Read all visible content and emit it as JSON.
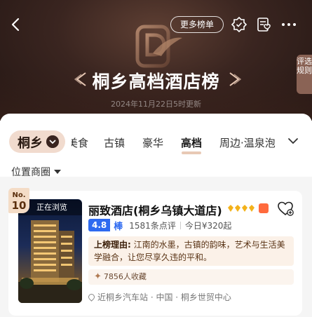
{
  "header": {
    "title": "桐乡高档酒店榜",
    "updated": "2024年11月22日5时更新",
    "more_lists_label": "更多榜单",
    "rules_label": "评选规则",
    "icons": [
      "back-arrow-icon",
      "badge-icon",
      "favorite-list-icon",
      "more-dots-icon"
    ],
    "colors": {
      "header_bg": "#3a2520",
      "accent_gold": "#e8c9b5"
    }
  },
  "tabs": {
    "city": "桐乡",
    "items": [
      "美食",
      "古镇",
      "豪华",
      "高档",
      "周边·温泉泡"
    ],
    "active": "高档"
  },
  "filter": {
    "label": "位置商圈"
  },
  "hotels": [
    {
      "rank_prefix": "No.",
      "rank": "10",
      "viewing_badge": "正在浏览",
      "name": "丽致酒店(桐乡乌镇大道店)",
      "diamonds": 4,
      "score": "4.8",
      "score_word": "棒",
      "reviews": "1581条点评",
      "price": "今日¥320起",
      "reason_label": "上榜理由:",
      "reason_text": "江南的水墨，古镇的韵味，艺术与生活美学融合，让您尽享久违的平和。",
      "favorites": "7856人收藏",
      "location": "近桐乡汽车站 · 中国 · 桐乡世贸中心"
    }
  ]
}
